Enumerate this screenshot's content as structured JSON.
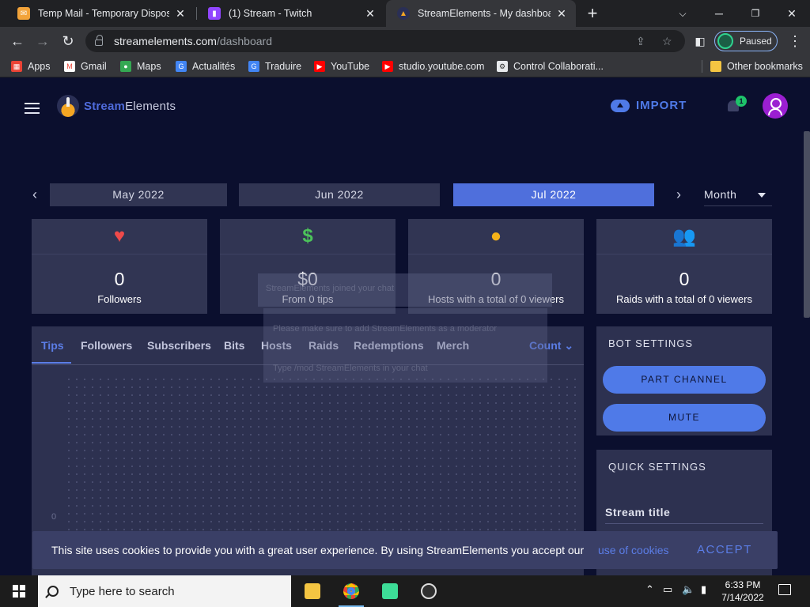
{
  "browser": {
    "tabs": [
      {
        "title": "Temp Mail - Temporary Disposable Email",
        "favicon": "envelope-icon"
      },
      {
        "title": "(1) Stream - Twitch",
        "favicon": "twitch-icon"
      },
      {
        "title": "StreamElements - My dashboard",
        "favicon": "streamelements-icon",
        "active": true
      }
    ],
    "url_host": "streamelements.com",
    "url_path": "/dashboard",
    "profile_status": "Paused",
    "bookmarks": [
      "Apps",
      "Gmail",
      "Maps",
      "Actualités",
      "Traduire",
      "YouTube",
      "studio.youtube.com",
      "Control Collaborati...",
      "Other bookmarks"
    ]
  },
  "header": {
    "brand_stream": "Stream",
    "brand_elements": "Elements",
    "import_label": "IMPORT",
    "notification_count": "1"
  },
  "months": {
    "items": [
      "May 2022",
      "Jun 2022",
      "Jul 2022"
    ],
    "selected": "Jul 2022",
    "period": "Month"
  },
  "stats": [
    {
      "icon": "heart-icon",
      "value": "0",
      "label": "Followers",
      "color": "#ef4a4a"
    },
    {
      "icon": "dollar-icon",
      "value": "$0",
      "label": "From 0 tips",
      "color": "#4cc35a"
    },
    {
      "icon": "user-circle-icon",
      "value": "0",
      "label": "Hosts with a total of 0 viewers",
      "color": "#f5b21a"
    },
    {
      "icon": "users-icon",
      "value": "0",
      "label": "Raids with a total of 0 viewers",
      "color": "#6aa6ee"
    }
  ],
  "activity": {
    "tabs": [
      "Tips",
      "Followers",
      "Subscribers",
      "Bits",
      "Hosts",
      "Raids",
      "Redemptions",
      "Merch"
    ],
    "active_tab": "Tips",
    "metric": "Count",
    "y_zero": "0"
  },
  "overlay_ghost": {
    "line1": "StreamElements joined your chat",
    "line2": "Please make sure to add StreamElements as a moderator",
    "line3": "Type /mod StreamElements in your chat"
  },
  "bot_settings": {
    "title": "BOT SETTINGS",
    "part_channel": "PART CHANNEL",
    "mute": "MUTE"
  },
  "quick_settings": {
    "title": "QUICK SETTINGS",
    "stream_title_label": "Stream title"
  },
  "cookie_banner": {
    "text": "This site uses cookies to provide you with a great user experience. By using StreamElements you accept our",
    "link": "use of cookies",
    "accept": "ACCEPT"
  },
  "taskbar": {
    "search_placeholder": "Type here to search",
    "time": "6:33 PM",
    "date": "7/14/2022"
  },
  "colors": {
    "page_bg": "#0b0f2e",
    "card_bg": "#313553",
    "accent": "#4f6fdc"
  }
}
